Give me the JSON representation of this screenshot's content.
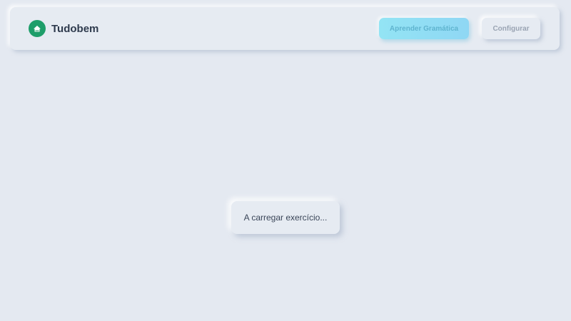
{
  "header": {
    "brand_name": "Tudobem",
    "logo_icon": "house-icon",
    "accent_color": "#1e9e6a",
    "nav": {
      "learn_label": "Aprender Gramática",
      "config_label": "Configurar"
    }
  },
  "main": {
    "loading_text": "A carregar exercício..."
  }
}
